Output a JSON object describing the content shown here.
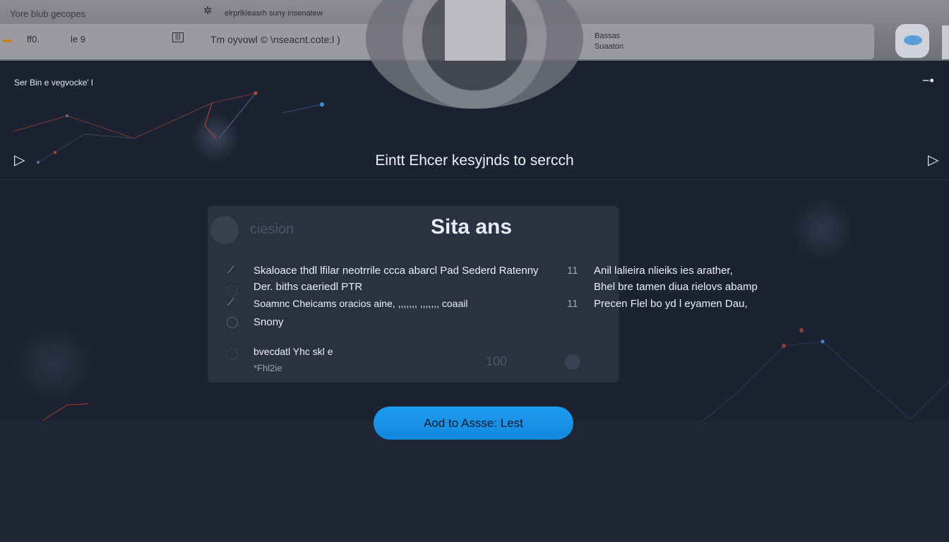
{
  "header": {
    "left_title": "Yore blub gecopes",
    "center_link": "elrprlkieasrh suny insenatew",
    "row_item_1": "ff0.",
    "row_item_2": "le 9",
    "row_item_3": "Tm oyvowl © \\nseacnt.cote:l )",
    "right_line_1": "Bassas",
    "right_line_2": "Suaaton"
  },
  "subheader": {
    "label": "Ser Bin e vegvocke' l",
    "minimize_glyph": "−•"
  },
  "search": {
    "hint": "Eintt Ehcer kesyjnds to sercch",
    "prev_glyph": "▷",
    "next_glyph": "▷"
  },
  "results": {
    "ghost_label": "ciesion",
    "title": "Sita ans",
    "rows": [
      {
        "left": "Skaloace thdl lfilar neotrrile ccca abarcl Pad Sederd Ratenny",
        "num": "11",
        "right": "Anil lalieira nlieiks ies arather,"
      },
      {
        "left": "Der. biths caeriedl PTR",
        "num": "",
        "right": "Bhel bre tamen diua rielovs abamp"
      },
      {
        "left": "Soamnc Cheicams oracios aine, ,,,,,,, ,,,,,,, coaail",
        "num": "11",
        "right": "Precen Flel bo yd l eyamen Dau,"
      },
      {
        "left": "Snony",
        "num": "",
        "right": ""
      }
    ],
    "footer_line_1": "bvecdatl Yhc skl e",
    "footer_line_2": "*Fhl2ie",
    "footer_num": "100"
  },
  "cta": {
    "label": "Aod to Assse: Lest",
    "color": "#1d9cf0"
  },
  "colors": {
    "background": "#1c2231",
    "topbar": "#8c8d92",
    "accent": "#1d9cf0"
  }
}
